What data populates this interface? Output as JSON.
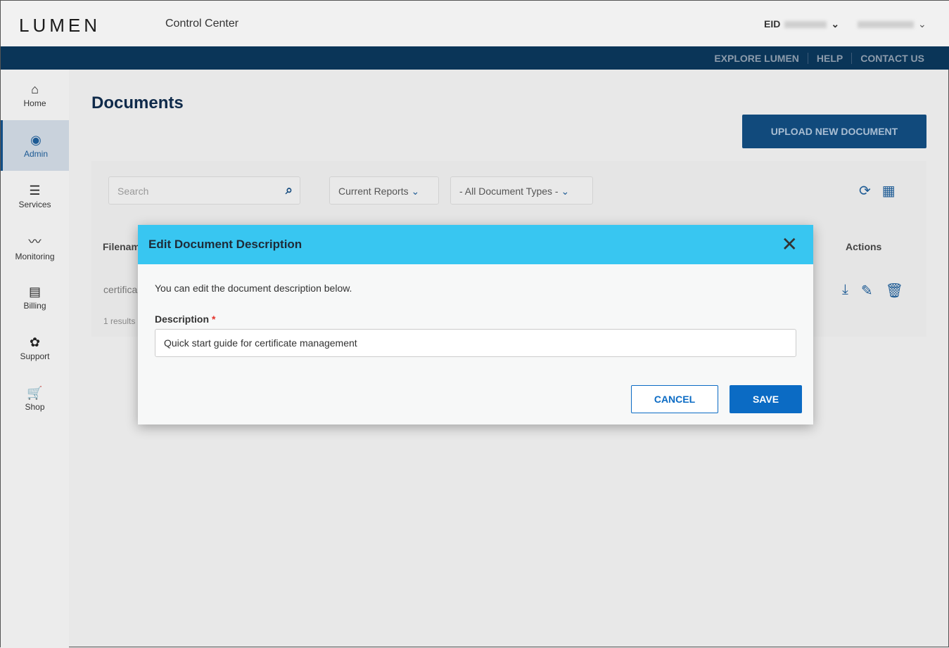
{
  "header": {
    "logo": "LUMEN",
    "app_name": "Control Center",
    "eid_label": "EID"
  },
  "topnav": {
    "links": [
      "EXPLORE LUMEN",
      "HELP",
      "CONTACT US"
    ]
  },
  "sidebar": {
    "items": [
      {
        "label": "Home",
        "icon": "⌂"
      },
      {
        "label": "Admin",
        "icon": "◉"
      },
      {
        "label": "Services",
        "icon": "☰"
      },
      {
        "label": "Monitoring",
        "icon": "〰"
      },
      {
        "label": "Billing",
        "icon": "▤"
      },
      {
        "label": "Support",
        "icon": "✿"
      },
      {
        "label": "Shop",
        "icon": "🛒"
      }
    ]
  },
  "page": {
    "title": "Documents",
    "upload_label": "UPLOAD NEW DOCUMENT",
    "search_placeholder": "Search",
    "filter_reports": "Current Reports",
    "filter_types": "- All Document Types -",
    "col_filename": "Filenam",
    "col_actions": "Actions",
    "row_filename": "certifica",
    "results": "1 results"
  },
  "modal": {
    "title": "Edit Document Description",
    "intro": "You can edit the document description below.",
    "field_label": "Description",
    "required_mark": "*",
    "field_value": "Quick start guide for certificate management",
    "cancel_label": "CANCEL",
    "save_label": "SAVE"
  }
}
